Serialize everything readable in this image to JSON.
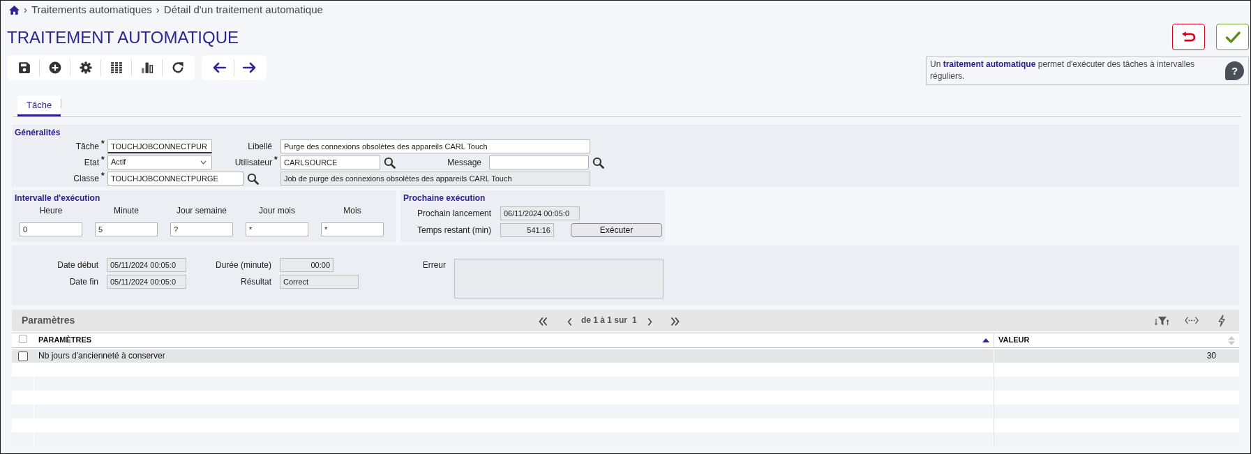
{
  "breadcrumb": [
    {
      "separator": "›",
      "label": "Traitements automatiques"
    },
    {
      "separator": "›",
      "label": "Détail d'un traitement automatique"
    }
  ],
  "page_title": "TRAITEMENT AUTOMATIQUE",
  "toolbar": [
    {
      "buttons": [
        {
          "kind": "save"
        },
        {
          "kind": "add"
        },
        {
          "kind": "settings"
        },
        {
          "kind": "columns"
        },
        {
          "kind": "chart"
        },
        {
          "kind": "refresh"
        }
      ]
    },
    {
      "buttons": [
        {
          "kind": "back"
        },
        {
          "kind": "forward"
        }
      ]
    }
  ],
  "actions": [
    {
      "kind": "cancel"
    },
    {
      "kind": "confirm"
    }
  ],
  "help": {
    "text": "Un **traitement automatique** permet d'exécuter des tâches à intervalles réguliers.",
    "button": "?"
  },
  "tabs": [
    {
      "label": "Tâche",
      "selected": true
    }
  ],
  "general": {
    "title": "Généralités",
    "rows": [
      [
        {
          "kind": "text",
          "label": "Tâche",
          "required_mark": "*",
          "value": "TOUCHJOBCONNECTPUR",
          "focused": true
        },
        {
          "kind": "text",
          "label": "Libellé",
          "value": "Purge des connexions obsolètes des appareils CARL Touch",
          "focused": false
        }
      ],
      [
        {
          "kind": "select",
          "label": "Etat",
          "required_mark": "*",
          "value": "Actif",
          "focused": false
        },
        {
          "kind": "lookup",
          "label": "Utilisateur",
          "required_mark": "*",
          "value": "CARLSOURCE",
          "focused": false
        },
        {
          "kind": "lookup",
          "label": "Message",
          "focused": false
        }
      ],
      [
        {
          "kind": "lookup",
          "label": "Classe",
          "required_mark": "*",
          "value": "TOUCHJOBCONNECTPURGE",
          "focused": false
        },
        {
          "kind": "display",
          "value": "Job de purge des connexions obsolètes des appareils CARL Touch",
          "focused": false
        }
      ]
    ]
  },
  "schedule": {
    "title": "Intervalle d'exécution",
    "fields": [
      {
        "label": "Heure",
        "value": "0"
      },
      {
        "label": "Minute",
        "value": "5"
      },
      {
        "label": "Jour semaine",
        "value": "?"
      },
      {
        "label": "Jour mois",
        "value": "*"
      },
      {
        "label": "Mois",
        "value": "*"
      }
    ]
  },
  "next_run": {
    "title": "Prochaine exécution",
    "fields": [
      {
        "kind": "date",
        "label": "Prochain lancement",
        "value": "06/11/2024 00:05:0",
        "readonly": true
      },
      {
        "kind": "duration",
        "label": "Temps restant (min)",
        "value": "541:16",
        "readonly": true
      }
    ],
    "button": "Exécuter"
  },
  "last_run": {
    "rows": [
      [
        {
          "kind": "date",
          "label": "Date début",
          "value": "05/11/2024 00:05:0",
          "readonly": true
        },
        {
          "kind": "duration",
          "label": "Durée (minute)",
          "value": "00:00",
          "readonly": true
        }
      ],
      [
        {
          "kind": "date",
          "label": "Date fin",
          "value": "05/11/2024 00:05:0",
          "readonly": true
        },
        {
          "kind": "text",
          "label": "Résultat",
          "value": "Correct",
          "readonly": true
        }
      ]
    ],
    "error": {
      "label": "Erreur",
      "readonly": true
    }
  },
  "parameters": {
    "title": "Paramètres",
    "pager": {
      "range": "de 1 à 1 sur",
      "total": "1"
    },
    "tools": [
      {
        "kind": "sort_filter"
      },
      {
        "kind": "expand"
      },
      {
        "kind": "actions"
      }
    ],
    "select_all_checked": false,
    "columns": [
      {
        "label": "PARAMÈTRES",
        "sorted": true
      },
      {
        "label": "VALEUR",
        "sorted": false
      }
    ],
    "rows": [
      {
        "cells": [
          "Nb jours d'ancienneté à conserver",
          "30"
        ],
        "checked": false,
        "selected": true
      }
    ]
  }
}
